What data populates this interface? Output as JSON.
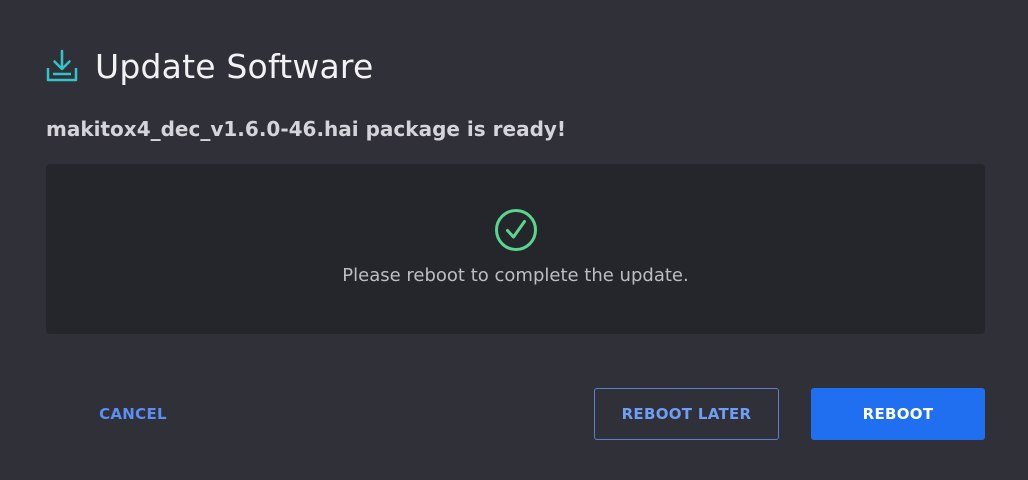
{
  "dialog": {
    "title": "Update Software",
    "title_icon": "download-tray-icon",
    "subtitle": "makitox4_dec_v1.6.0-46.hai package is ready!",
    "message_icon": "check-circle-icon",
    "message": "Please reboot to complete the update.",
    "buttons": {
      "cancel": "CANCEL",
      "reboot_later": "REBOOT LATER",
      "reboot": "REBOOT"
    },
    "colors": {
      "background": "#303038",
      "panel": "#25262b",
      "accent_teal": "#34c3c7",
      "success_green": "#58d68d",
      "primary_blue": "#1f6ff0",
      "link_blue": "#5d8ef3"
    }
  }
}
